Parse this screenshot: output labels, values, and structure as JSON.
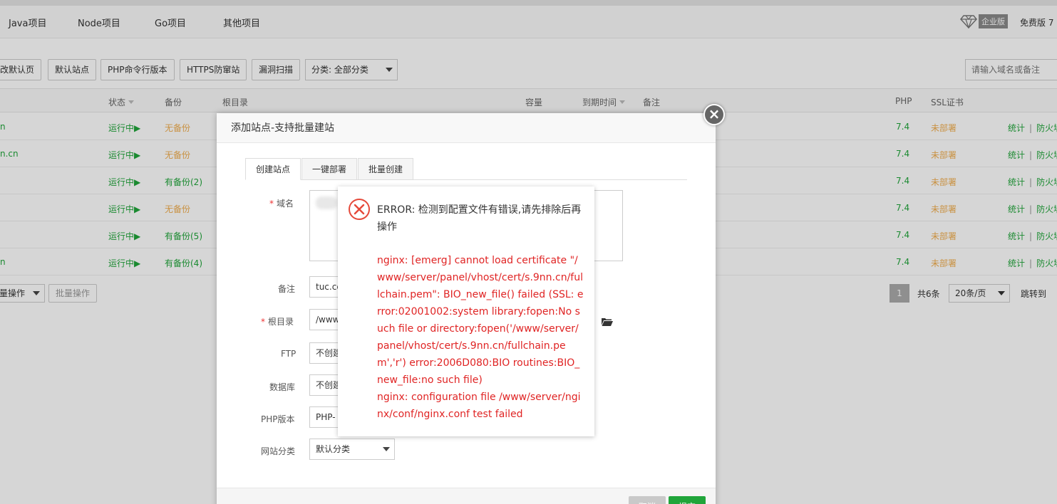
{
  "topnav": {
    "tabs": [
      "Java项目",
      "Node项目",
      "Go项目",
      "其他项目"
    ],
    "badge": "企业版",
    "free_edition": "免费版",
    "free_suffix": "7"
  },
  "toolbar": {
    "buttons": [
      "改默认页",
      "默认站点",
      "PHP命令行版本",
      "HTTPS防窜站",
      "漏洞扫描"
    ],
    "category_select": "分类: 全部分类",
    "search_placeholder": "请输入域名或备注"
  },
  "table": {
    "headers": {
      "status": "状态",
      "backup": "备份",
      "root": "根目录",
      "capacity": "容量",
      "expire": "到期时间",
      "note": "备注",
      "php": "PHP",
      "ssl": "SSL证书"
    },
    "rows": [
      {
        "name": "n",
        "status": "运行中▶",
        "backup": "无备份",
        "php": "7.4",
        "ssl": "未部署",
        "stats": "统计",
        "firewall": "防火墙"
      },
      {
        "name": "n.cn",
        "status": "运行中▶",
        "backup": "无备份",
        "php": "7.4",
        "ssl": "未部署",
        "stats": "统计",
        "firewall": "防火墙"
      },
      {
        "name": "",
        "status": "运行中▶",
        "backup": "有备份(2)",
        "php": "7.4",
        "ssl": "未部署",
        "stats": "统计",
        "firewall": "防火墙"
      },
      {
        "name": "",
        "status": "运行中▶",
        "backup": "无备份",
        "php": "7.4",
        "ssl": "未部署",
        "stats": "统计",
        "firewall": "防火墙"
      },
      {
        "name": "",
        "status": "运行中▶",
        "backup": "有备份(5)",
        "php": "7.4",
        "ssl": "未部署",
        "stats": "统计",
        "firewall": "防火墙"
      },
      {
        "name": "n",
        "status": "运行中▶",
        "backup": "有备份(4)",
        "php": "7.4",
        "ssl": "未部署",
        "stats": "统计",
        "firewall": "防火墙"
      }
    ],
    "bulk_select": "量操作",
    "bulk_button": "批量操作",
    "pagination": {
      "current_page": "1",
      "total": "共6条",
      "per_page": "20条/页",
      "jump_to": "跳转到"
    }
  },
  "modal": {
    "title": "添加站点-支持批量建站",
    "close_glyph": "×",
    "tabs": [
      "创建站点",
      "一键部署",
      "批量创建"
    ],
    "labels": {
      "domain": "域名",
      "note": "备注",
      "root": "根目录",
      "ftp": "FTP",
      "database": "数据库",
      "php_version": "PHP版本",
      "site_category": "网站分类"
    },
    "values": {
      "note": "tuc.cc",
      "root": "/www",
      "ftp": "不创建",
      "database": "不创建",
      "php_version": "PHP-",
      "site_category": "默认分类"
    },
    "required_mark": "*",
    "footer": {
      "cancel": "取消",
      "submit": "提交"
    }
  },
  "error": {
    "title": "ERROR: 检测到配置文件有错误,请先排除后再操作",
    "detail_1": "nginx: [emerg] cannot load certificate \"/www/server/panel/vhost/cert/s.9nn.cn/fullchain.pem\": BIO_new_file() failed (SSL: error:02001002:system library:fopen:No such file or directory:fopen('/www/server/panel/vhost/cert/s.9nn.cn/fullchain.pem','r') error:2006D080:BIO routines:BIO_new_file:no such file)",
    "detail_2": "nginx: configuration file /www/server/nginx/conf/nginx.conf test failed"
  },
  "colors": {
    "brand_green": "#20a53a",
    "warning_orange": "#f0ad4e",
    "error_red": "#e02424"
  },
  "icons": [
    "diamond-icon",
    "folder-icon",
    "close-icon",
    "error-circle-icon",
    "chevron-down-icon",
    "sort-caret-icon"
  ]
}
